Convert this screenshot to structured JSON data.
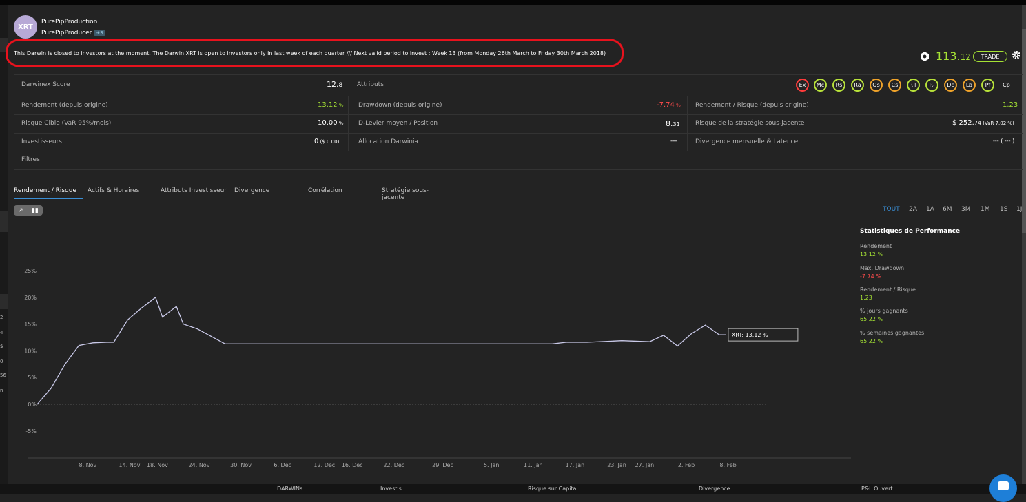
{
  "header": {
    "avatar_text": "XRT",
    "name": "PurePipProduction",
    "producer": "PurePipProducer",
    "producer_badge": "+3",
    "notice": "This Darwin is closed to investors at the moment. The Darwin XRT is open to investors only in last week of each quarter /// Next valid period to invest : Week 13 (from Monday 26th March to Friday 30th March 2018)",
    "price_main": "113.",
    "price_dec": "12",
    "trade_label": "TRADE"
  },
  "metrics": {
    "score_label": "Darwinex Score",
    "score_main": "12.",
    "score_dec": "8",
    "attributes_label": "Attributs",
    "attributes": [
      "Ex",
      "Mc",
      "Rs",
      "Ra",
      "Os",
      "Cs",
      "R+",
      "R-",
      "Dc",
      "La",
      "Pf",
      "Cp"
    ],
    "rendement_label": "Rendement (depuis origine)",
    "rendement_main": "13.12",
    "rendement_unit": " %",
    "drawdown_label": "Drawdown (depuis origine)",
    "drawdown_main": "-7.74",
    "drawdown_unit": " %",
    "rr_label": "Rendement / Risque (depuis origine)",
    "rr_value": "1.23",
    "risque_label": "Risque Cible (VaR 95%/mois)",
    "risque_main": "10.00",
    "risque_unit": " %",
    "levier_label": "D-Levier moyen / Position",
    "levier_main": "8.",
    "levier_dec": "31",
    "strat_label": "Risque de la stratégie sous-jacente",
    "strat_main": "$ 252.",
    "strat_dec": "74",
    "strat_var": " (VaR 7.02 %)",
    "investors_label": "Investisseurs",
    "investors_main": "0",
    "investors_sub": " ($ 0.00)",
    "alloc_label": "Allocation Darwinia",
    "alloc_value": "---",
    "divergence_label": "Divergence mensuelle & Latence",
    "divergence_value": "--- ( --- )",
    "filters_label": "Filtres"
  },
  "tabs": [
    "Rendement / Risque",
    "Actifs & Horaires",
    "Attributs Investisseur",
    "Divergence",
    "Corrélation",
    "Stratégie sous-jacente"
  ],
  "ranges": [
    "TOUT",
    "2A",
    "1A",
    "6M",
    "3M",
    "1M",
    "1S",
    "1J"
  ],
  "stats": {
    "title": "Statistiques de Performance",
    "items": [
      {
        "label": "Rendement",
        "value": "13.12 %"
      },
      {
        "label": "Max. Drawdown",
        "value": "-7.74 %"
      },
      {
        "label": "Rendement / Risque",
        "value": "1.23"
      },
      {
        "label": "% jours gagnants",
        "value": "65.22 %"
      },
      {
        "label": "% semaines gagnantes",
        "value": "65.22 %"
      }
    ]
  },
  "bottom_nav": [
    "DARWINs",
    "Investis",
    "Risque sur Capital",
    "Divergence",
    "P&L Ouvert"
  ],
  "colors": {
    "positive": "#a5e234",
    "negative": "#ff4c4c",
    "accent": "#3a8fd6",
    "line": "#c9c9e8",
    "alert": "#e8121d"
  },
  "chart_data": {
    "type": "line",
    "series": [
      {
        "name": "XRT",
        "last_label": "XRT: 13.12 %",
        "x": [
          "2017-11-04",
          "2017-11-06",
          "2017-11-08",
          "2017-11-10",
          "2017-11-12",
          "2017-11-14",
          "2017-11-15",
          "2017-11-17",
          "2017-11-19",
          "2017-11-21",
          "2017-11-22",
          "2017-11-24",
          "2017-11-25",
          "2017-11-27",
          "2017-12-01",
          "2017-12-10",
          "2017-12-20",
          "2017-12-30",
          "2018-01-09",
          "2018-01-17",
          "2018-01-19",
          "2018-01-22",
          "2018-01-27",
          "2018-01-31",
          "2018-02-02",
          "2018-02-04",
          "2018-02-06",
          "2018-02-08",
          "2018-02-10",
          "2018-02-11"
        ],
        "y": [
          0.0,
          3.0,
          7.5,
          11.0,
          11.5,
          11.6,
          11.6,
          15.8,
          18.0,
          20.0,
          16.3,
          18.3,
          15.0,
          14.1,
          11.3,
          11.3,
          11.3,
          11.3,
          11.3,
          11.3,
          11.6,
          11.6,
          11.9,
          11.7,
          12.9,
          10.9,
          13.2,
          14.8,
          13.0,
          13.0
        ]
      }
    ],
    "y_ticks": [
      "25%",
      "20%",
      "15%",
      "10%",
      "5%",
      "0%",
      "-5%"
    ],
    "x_ticks": [
      "8. Nov",
      "14. Nov",
      "18. Nov",
      "24. Nov",
      "30. Nov",
      "6. Dec",
      "12. Dec",
      "16. Dec",
      "22. Dec",
      "29. Dec",
      "5. Jan",
      "11. Jan",
      "17. Jan",
      "23. Jan",
      "27. Jan",
      "2. Feb",
      "8. Feb"
    ],
    "ylim": [
      -5,
      25
    ],
    "grid": false
  }
}
